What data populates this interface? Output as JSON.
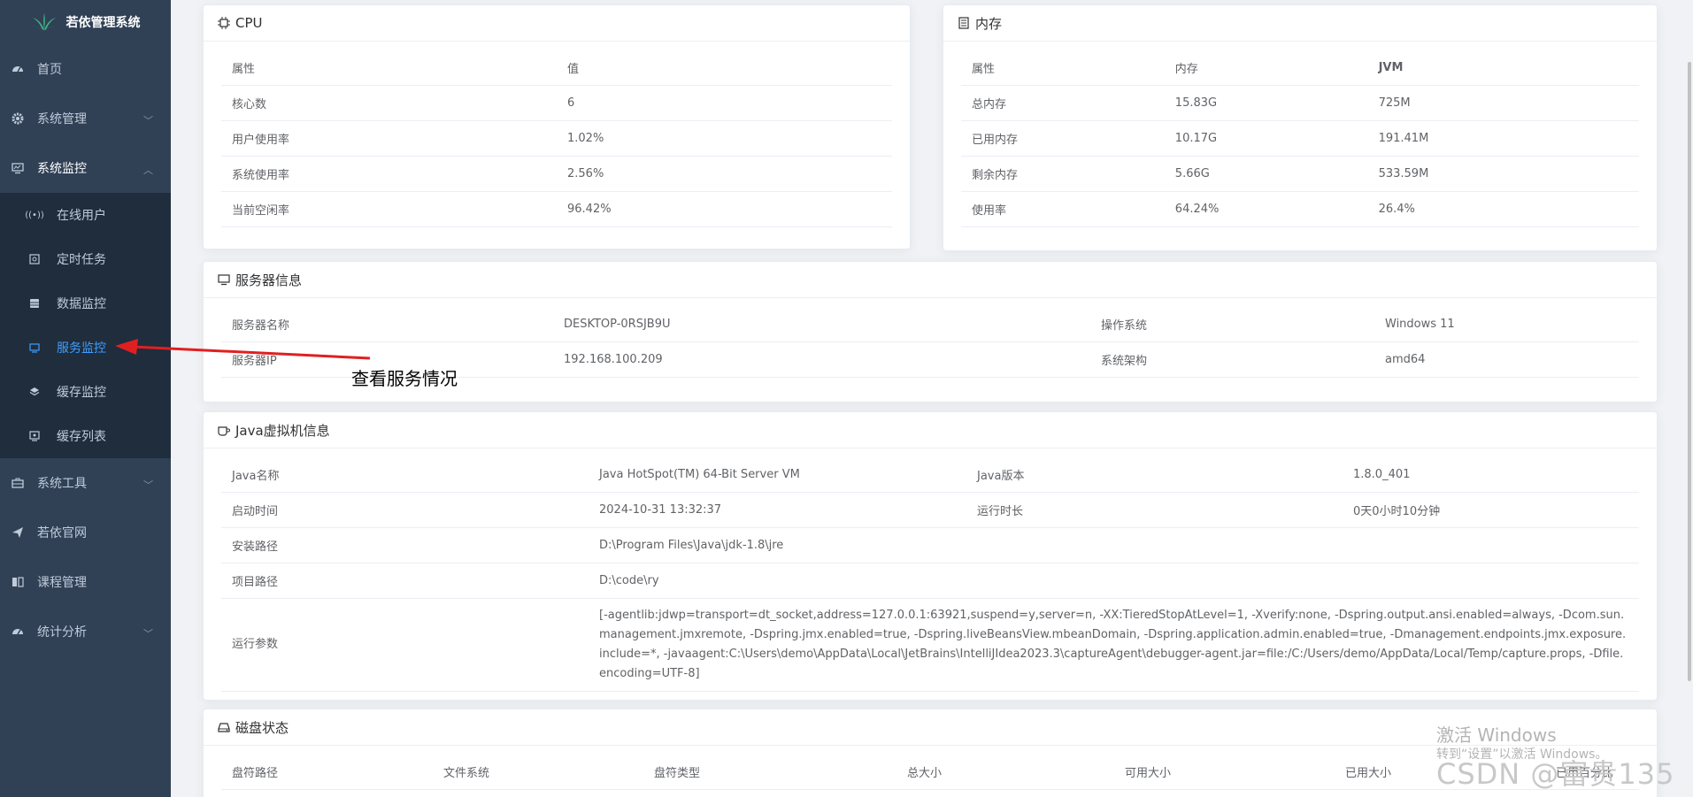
{
  "app": {
    "title": "若依管理系统"
  },
  "sidebar": {
    "items": [
      {
        "label": "首页"
      },
      {
        "label": "系统管理"
      },
      {
        "label": "系统监控"
      },
      {
        "label": "系统工具"
      },
      {
        "label": "若依官网"
      },
      {
        "label": "课程管理"
      },
      {
        "label": "统计分析"
      }
    ],
    "monitor_sub": [
      {
        "label": "在线用户"
      },
      {
        "label": "定时任务"
      },
      {
        "label": "数据监控"
      },
      {
        "label": "服务监控"
      },
      {
        "label": "缓存监控"
      },
      {
        "label": "缓存列表"
      }
    ]
  },
  "cpu": {
    "title": "CPU",
    "headers": [
      "属性",
      "值"
    ],
    "rows": [
      [
        "核心数",
        "6"
      ],
      [
        "用户使用率",
        "1.02%"
      ],
      [
        "系统使用率",
        "2.56%"
      ],
      [
        "当前空闲率",
        "96.42%"
      ]
    ]
  },
  "mem": {
    "title": "内存",
    "headers": [
      "属性",
      "内存",
      "JVM"
    ],
    "rows": [
      [
        "总内存",
        "15.83G",
        "725M"
      ],
      [
        "已用内存",
        "10.17G",
        "191.41M"
      ],
      [
        "剩余内存",
        "5.66G",
        "533.59M"
      ],
      [
        "使用率",
        "64.24%",
        "26.4%"
      ]
    ]
  },
  "server": {
    "title": "服务器信息",
    "rows": [
      [
        "服务器名称",
        "DESKTOP-0RSJB9U",
        "操作系统",
        "Windows 11"
      ],
      [
        "服务器IP",
        "192.168.100.209",
        "系统架构",
        "amd64"
      ]
    ]
  },
  "jvm": {
    "title": "Java虚拟机信息",
    "rows": [
      [
        "Java名称",
        "Java HotSpot(TM) 64-Bit Server VM",
        "Java版本",
        "1.8.0_401"
      ],
      [
        "启动时间",
        "2024-10-31 13:32:37",
        "运行时长",
        "0天0小时10分钟"
      ]
    ],
    "install_label": "安装路径",
    "install_value": "D:\\Program Files\\Java\\jdk-1.8\\jre",
    "project_label": "项目路径",
    "project_value": "D:\\code\\ry",
    "args_label": "运行参数",
    "args_value": "[-agentlib:jdwp=transport=dt_socket,address=127.0.0.1:63921,suspend=y,server=n, -XX:TieredStopAtLevel=1, -Xverify:none, -Dspring.output.ansi.enabled=always, -Dcom.sun.management.jmxremote, -Dspring.jmx.enabled=true, -Dspring.liveBeansView.mbeanDomain, -Dspring.application.admin.enabled=true, -Dmanagement.endpoints.jmx.exposure.include=*, -javaagent:C:\\Users\\demo\\AppData\\Local\\JetBrains\\IntelliJIdea2023.3\\captureAgent\\debugger-agent.jar=file:/C:/Users/demo/AppData/Local/Temp/capture.props, -Dfile.encoding=UTF-8]"
  },
  "disk": {
    "title": "磁盘状态",
    "headers": [
      "盘符路径",
      "文件系统",
      "盘符类型",
      "总大小",
      "可用大小",
      "已用大小",
      "已用百分比"
    ]
  },
  "annotation": {
    "text": "查看服务情况"
  },
  "watermark": {
    "line1": "激活 Windows",
    "line2": "转到“设置”以激活 Windows。",
    "line3": "CSDN @富贵135"
  }
}
